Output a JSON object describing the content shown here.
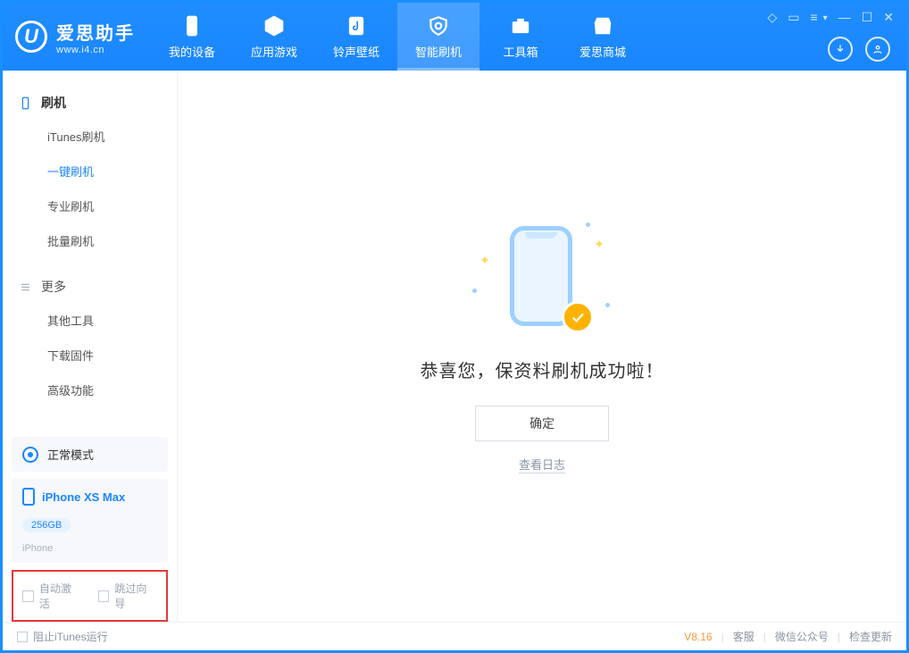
{
  "colors": {
    "accent": "#1a86ff",
    "highlight_border": "#e5393a",
    "success_badge": "#ffb300"
  },
  "logo": {
    "mark": "U",
    "title": "爱思助手",
    "subtitle": "www.i4.cn"
  },
  "tabs": [
    {
      "id": "device",
      "label": "我的设备"
    },
    {
      "id": "apps",
      "label": "应用游戏"
    },
    {
      "id": "ringtone",
      "label": "铃声壁纸"
    },
    {
      "id": "flash",
      "label": "智能刷机"
    },
    {
      "id": "toolbox",
      "label": "工具箱"
    },
    {
      "id": "store",
      "label": "爱思商城"
    }
  ],
  "active_tab_id": "flash",
  "sidebar": {
    "groups": [
      {
        "title": "刷机",
        "items": [
          {
            "label": "iTunes刷机"
          },
          {
            "label": "一键刷机",
            "active": true
          },
          {
            "label": "专业刷机"
          },
          {
            "label": "批量刷机"
          }
        ]
      },
      {
        "title": "更多",
        "items": [
          {
            "label": "其他工具"
          },
          {
            "label": "下载固件"
          },
          {
            "label": "高级功能"
          }
        ]
      }
    ],
    "mode_card": {
      "label": "正常模式"
    },
    "device_card": {
      "name": "iPhone XS Max",
      "storage": "256GB",
      "type": "iPhone"
    },
    "checks": {
      "auto_activate": "自动激活",
      "skip_guide": "跳过向导"
    }
  },
  "main": {
    "success_text": "恭喜您，保资料刷机成功啦！",
    "ok_button": "确定",
    "view_log": "查看日志"
  },
  "statusbar": {
    "block_itunes": "阻止iTunes运行",
    "version": "V8.16",
    "links": [
      "客服",
      "微信公众号",
      "检查更新"
    ]
  }
}
